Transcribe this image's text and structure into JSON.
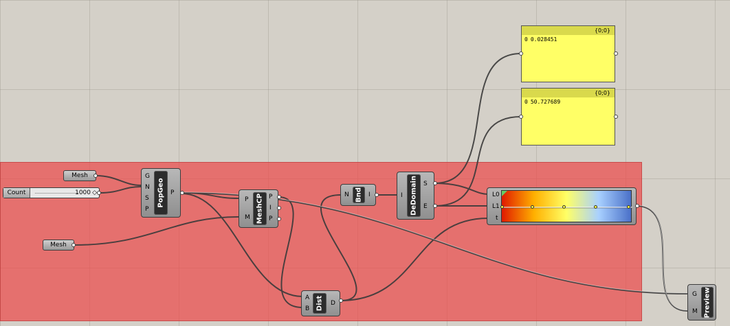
{
  "params": {
    "mesh1": "Mesh",
    "mesh2": "Mesh"
  },
  "slider": {
    "label": "Count",
    "value": "1000",
    "knob": "◇"
  },
  "popgeo": {
    "name": "PopGeo",
    "inputs": [
      "G",
      "N",
      "S",
      "P"
    ],
    "outputs": [
      "P"
    ]
  },
  "meshcp": {
    "name": "MeshCP",
    "inputs": [
      "P",
      "M"
    ],
    "outputs": [
      "P",
      "I",
      "P"
    ]
  },
  "bnd": {
    "name": "Bnd",
    "inputs": [
      "N"
    ],
    "outputs": [
      "I"
    ]
  },
  "dedomain": {
    "name": "DeDomain",
    "inputs": [
      "I"
    ],
    "outputs": [
      "S",
      "E"
    ]
  },
  "dist": {
    "name": "Dist",
    "inputs": [
      "A",
      "B"
    ],
    "outputs": [
      "D"
    ]
  },
  "gradient": {
    "inputs": [
      "L0",
      "L1",
      "t"
    ],
    "colors": [
      "#e01a00",
      "#ffb000",
      "#ffff66",
      "#a8d0ff",
      "#4a70c8"
    ]
  },
  "preview": {
    "name": "Preview",
    "inputs": [
      "G",
      "M"
    ]
  },
  "panel1": {
    "header": "{0;0}",
    "index": "0",
    "value": "0.028451"
  },
  "panel2": {
    "header": "{0;0}",
    "index": "0",
    "value": "50.727689"
  },
  "colors": {
    "group": "#eb4b4b",
    "panel": "#ffff66",
    "canvas": "#d4d0c8"
  }
}
